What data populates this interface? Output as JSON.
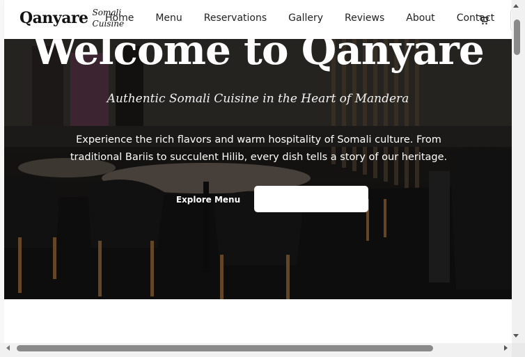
{
  "brand": {
    "name": "Qanyare",
    "tag_line1": "Somali",
    "tag_line2": "Cuisine"
  },
  "nav": {
    "items": [
      "Home",
      "Menu",
      "Reservations",
      "Gallery",
      "Reviews",
      "About",
      "Contact"
    ]
  },
  "icons": {
    "cart": "cart-icon"
  },
  "hero": {
    "title": "Welcome to Qanyare",
    "subtitle": "Authentic Somali Cuisine in the Heart of Mandera",
    "description": "Experience the rich flavors and warm hospitality of Somali culture. From traditional Bariis to succulent Hilib, every dish tells a story of our heritage.",
    "primary_button": "Explore Menu",
    "secondary_button": ""
  },
  "colors": {
    "text_dark": "#121212",
    "white": "#ffffff",
    "scroll_thumb": "#8a8a8a"
  }
}
